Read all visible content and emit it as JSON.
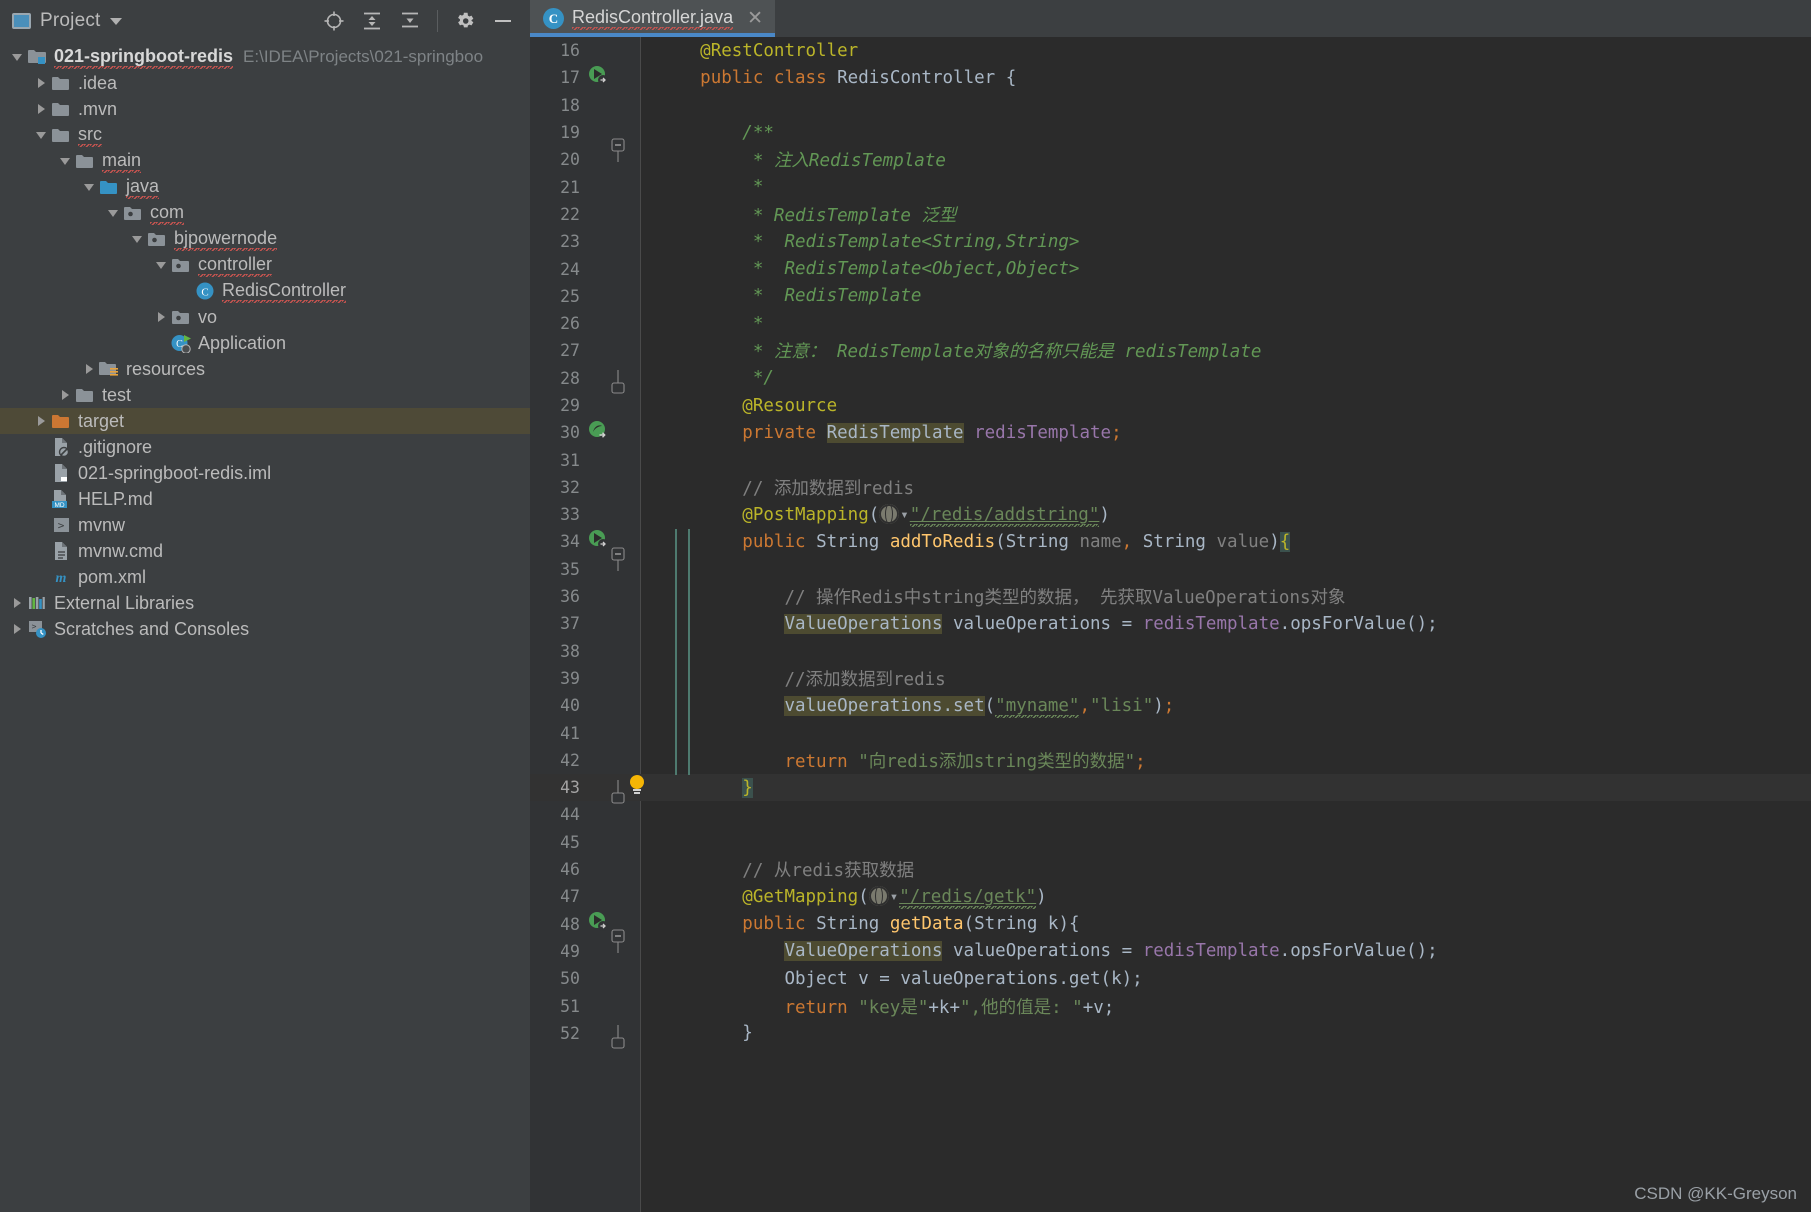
{
  "project_panel": {
    "header": {
      "title": "Project",
      "icon": "project-window-icon",
      "dropdown_icon": "chevron-down-icon",
      "buttons": [
        {
          "name": "select-opened-file-icon",
          "label": "Select Opened File"
        },
        {
          "name": "expand-all-icon",
          "label": "Expand All"
        },
        {
          "name": "collapse-all-icon",
          "label": "Collapse All"
        },
        {
          "name": "gear-icon",
          "label": "Options"
        },
        {
          "name": "minimize-icon",
          "label": "Hide"
        }
      ]
    },
    "tree": [
      {
        "label": "021-springboot-redis",
        "sub": "E:\\IDEA\\Projects\\021-springboo",
        "icon": "module-folder-icon",
        "depth": 0,
        "arrow": "down",
        "bold": true,
        "squiggly": true
      },
      {
        "label": ".idea",
        "icon": "folder-icon",
        "depth": 1,
        "arrow": "right"
      },
      {
        "label": ".mvn",
        "icon": "folder-icon",
        "depth": 1,
        "arrow": "right"
      },
      {
        "label": "src",
        "icon": "folder-icon",
        "depth": 1,
        "arrow": "down",
        "squiggly": true
      },
      {
        "label": "main",
        "icon": "folder-icon",
        "depth": 2,
        "arrow": "down",
        "squiggly": true
      },
      {
        "label": "java",
        "icon": "source-root-icon",
        "depth": 3,
        "arrow": "down",
        "squiggly": true
      },
      {
        "label": "com",
        "icon": "package-icon",
        "depth": 4,
        "arrow": "down",
        "squiggly": true
      },
      {
        "label": "bjpowernode",
        "icon": "package-icon",
        "depth": 5,
        "arrow": "down",
        "squiggly": true
      },
      {
        "label": "controller",
        "icon": "package-icon",
        "depth": 6,
        "arrow": "down",
        "squiggly": true
      },
      {
        "label": "RedisController",
        "icon": "java-class-icon",
        "depth": 7,
        "arrow": "none",
        "squiggly": true
      },
      {
        "label": "vo",
        "icon": "package-icon",
        "depth": 6,
        "arrow": "right"
      },
      {
        "label": "Application",
        "icon": "spring-boot-class-icon",
        "depth": 6,
        "arrow": "none"
      },
      {
        "label": "resources",
        "icon": "resources-folder-icon",
        "depth": 3,
        "arrow": "right"
      },
      {
        "label": "test",
        "icon": "folder-icon",
        "depth": 2,
        "arrow": "right"
      },
      {
        "label": "target",
        "icon": "excluded-folder-icon",
        "depth": 1,
        "arrow": "right",
        "selected": true
      },
      {
        "label": ".gitignore",
        "icon": "gitignore-file-icon",
        "depth": 1,
        "arrow": "none"
      },
      {
        "label": "021-springboot-redis.iml",
        "icon": "iml-file-icon",
        "depth": 1,
        "arrow": "none"
      },
      {
        "label": "HELP.md",
        "icon": "markdown-file-icon",
        "depth": 1,
        "arrow": "none"
      },
      {
        "label": "mvnw",
        "icon": "shell-script-icon",
        "depth": 1,
        "arrow": "none"
      },
      {
        "label": "mvnw.cmd",
        "icon": "cmd-script-icon",
        "depth": 1,
        "arrow": "none"
      },
      {
        "label": "pom.xml",
        "icon": "maven-file-icon",
        "depth": 1,
        "arrow": "none"
      },
      {
        "label": "External Libraries",
        "icon": "libraries-icon",
        "depth": 0,
        "arrow": "right"
      },
      {
        "label": "Scratches and Consoles",
        "icon": "scratches-icon",
        "depth": 0,
        "arrow": "right"
      }
    ]
  },
  "editor": {
    "tab": {
      "label": "RedisController.java",
      "icon": "java-class-icon",
      "close_icon": "close-icon"
    },
    "first_line_number": 16,
    "current_line": 43,
    "lines": [
      {
        "n": 16,
        "indent": 1,
        "tokens": [
          {
            "t": "@RestController",
            "c": "ann"
          }
        ]
      },
      {
        "n": 17,
        "indent": 1,
        "gutter": "run",
        "tokens": [
          {
            "t": "public ",
            "c": "kw"
          },
          {
            "t": "class ",
            "c": "kw"
          },
          {
            "t": "RedisController ",
            "c": "cls"
          },
          {
            "t": "{",
            "c": "ident"
          }
        ]
      },
      {
        "n": 18,
        "indent": 1,
        "tokens": []
      },
      {
        "n": 19,
        "indent": 2,
        "fold": "top",
        "tokens": [
          {
            "t": "/**",
            "c": "jdoc"
          }
        ]
      },
      {
        "n": 20,
        "indent": 2,
        "tokens": [
          {
            "t": " * 注入RedisTemplate",
            "c": "jdoc"
          }
        ]
      },
      {
        "n": 21,
        "indent": 2,
        "tokens": [
          {
            "t": " *",
            "c": "jdoc"
          }
        ]
      },
      {
        "n": 22,
        "indent": 2,
        "tokens": [
          {
            "t": " * RedisTemplate 泛型",
            "c": "jdoc"
          }
        ]
      },
      {
        "n": 23,
        "indent": 2,
        "tokens": [
          {
            "t": " *  RedisTemplate<String,String>",
            "c": "jdoc"
          }
        ]
      },
      {
        "n": 24,
        "indent": 2,
        "tokens": [
          {
            "t": " *  RedisTemplate<Object,Object>",
            "c": "jdoc"
          }
        ]
      },
      {
        "n": 25,
        "indent": 2,
        "tokens": [
          {
            "t": " *  RedisTemplate",
            "c": "jdoc"
          }
        ]
      },
      {
        "n": 26,
        "indent": 2,
        "tokens": [
          {
            "t": " *",
            "c": "jdoc"
          }
        ]
      },
      {
        "n": 27,
        "indent": 2,
        "tokens": [
          {
            "t": " * 注意： RedisTemplate对象的名称只能是 redisTemplate",
            "c": "jdoc"
          }
        ]
      },
      {
        "n": 28,
        "indent": 2,
        "fold": "bottom",
        "tokens": [
          {
            "t": " */",
            "c": "jdoc"
          }
        ]
      },
      {
        "n": 29,
        "indent": 2,
        "tokens": [
          {
            "t": "@Resource",
            "c": "ann"
          }
        ]
      },
      {
        "n": 30,
        "indent": 2,
        "gutter": "bean",
        "tokens": [
          {
            "t": "private ",
            "c": "kw"
          },
          {
            "t": "RedisTemplate",
            "c": "mark"
          },
          {
            "t": " ",
            "c": "ident"
          },
          {
            "t": "redisTemplate",
            "c": "fld"
          },
          {
            "t": ";",
            "c": "kw"
          }
        ]
      },
      {
        "n": 31,
        "indent": 2,
        "tokens": []
      },
      {
        "n": 32,
        "indent": 2,
        "tokens": [
          {
            "t": "// 添加数据到redis",
            "c": "cmt"
          }
        ]
      },
      {
        "n": 33,
        "indent": 2,
        "tokens": [
          {
            "t": "@PostMapping",
            "c": "ann"
          },
          {
            "t": "(",
            "c": "ident"
          },
          {
            "t": "GLOBE",
            "c": "globe"
          },
          {
            "t": "\"/redis/addstring\"",
            "c": "urlstr"
          },
          {
            "t": ")",
            "c": "ident"
          }
        ]
      },
      {
        "n": 34,
        "indent": 2,
        "gutter": "run",
        "fold": "top",
        "tokens": [
          {
            "t": "public ",
            "c": "kw"
          },
          {
            "t": "String ",
            "c": "typ"
          },
          {
            "t": "addToRedis",
            "c": "mth"
          },
          {
            "t": "(",
            "c": "ident"
          },
          {
            "t": "String ",
            "c": "typ"
          },
          {
            "t": "name",
            "c": "cmt"
          },
          {
            "t": ", ",
            "c": "kw"
          },
          {
            "t": "String ",
            "c": "typ"
          },
          {
            "t": "value",
            "c": "cmt"
          },
          {
            "t": ")",
            "c": "ident"
          },
          {
            "t": "{",
            "c": "brace-hl"
          }
        ]
      },
      {
        "n": 35,
        "indent": 2,
        "tokens": []
      },
      {
        "n": 36,
        "indent": 3,
        "tokens": [
          {
            "t": "// 操作Redis中string类型的数据， 先获取ValueOperations对象",
            "c": "cmt"
          }
        ]
      },
      {
        "n": 37,
        "indent": 3,
        "tokens": [
          {
            "t": "ValueOperations",
            "c": "mark"
          },
          {
            "t": " valueOperations ",
            "c": "ident"
          },
          {
            "t": "= ",
            "c": "ident"
          },
          {
            "t": "redisTemplate",
            "c": "fld"
          },
          {
            "t": ".opsForValue();",
            "c": "ident"
          }
        ]
      },
      {
        "n": 38,
        "indent": 3,
        "tokens": []
      },
      {
        "n": 39,
        "indent": 3,
        "tokens": [
          {
            "t": "//添加数据到redis",
            "c": "cmt"
          }
        ]
      },
      {
        "n": 40,
        "indent": 3,
        "tokens": [
          {
            "t": "valueOperations.set",
            "c": "mark"
          },
          {
            "t": "(",
            "c": "ident"
          },
          {
            "t": "\"myname\"",
            "c": "str-sq"
          },
          {
            "t": ",",
            "c": "kw"
          },
          {
            "t": "\"lisi\"",
            "c": "str"
          },
          {
            "t": ")",
            "c": "ident"
          },
          {
            "t": ";",
            "c": "kw"
          }
        ]
      },
      {
        "n": 41,
        "indent": 3,
        "tokens": []
      },
      {
        "n": 42,
        "indent": 3,
        "tokens": [
          {
            "t": "return ",
            "c": "kw"
          },
          {
            "t": "\"向redis添加string类型的数据\"",
            "c": "str"
          },
          {
            "t": ";",
            "c": "kw"
          }
        ]
      },
      {
        "n": 43,
        "indent": 2,
        "current": true,
        "gutter": "bulb",
        "fold": "bottom",
        "tokens": [
          {
            "t": "}",
            "c": "brace-hl"
          }
        ]
      },
      {
        "n": 44,
        "indent": 2,
        "tokens": []
      },
      {
        "n": 45,
        "indent": 2,
        "tokens": []
      },
      {
        "n": 46,
        "indent": 2,
        "tokens": [
          {
            "t": "// 从redis获取数据",
            "c": "cmt"
          }
        ]
      },
      {
        "n": 47,
        "indent": 2,
        "tokens": [
          {
            "t": "@GetMapping",
            "c": "ann"
          },
          {
            "t": "(",
            "c": "ident"
          },
          {
            "t": "GLOBE",
            "c": "globe"
          },
          {
            "t": "\"/redis/getk\"",
            "c": "urlstr"
          },
          {
            "t": ")",
            "c": "ident"
          }
        ]
      },
      {
        "n": 48,
        "indent": 2,
        "gutter": "run",
        "fold": "top",
        "tokens": [
          {
            "t": "public ",
            "c": "kw"
          },
          {
            "t": "String ",
            "c": "typ"
          },
          {
            "t": "getData",
            "c": "mth"
          },
          {
            "t": "(",
            "c": "ident"
          },
          {
            "t": "String ",
            "c": "typ"
          },
          {
            "t": "k",
            "c": "ident"
          },
          {
            "t": "){",
            "c": "ident"
          }
        ]
      },
      {
        "n": 49,
        "indent": 3,
        "tokens": [
          {
            "t": "ValueOperations",
            "c": "mark"
          },
          {
            "t": " valueOperations ",
            "c": "ident"
          },
          {
            "t": "= ",
            "c": "ident"
          },
          {
            "t": "redisTemplate",
            "c": "fld"
          },
          {
            "t": ".opsForValue();",
            "c": "ident"
          }
        ]
      },
      {
        "n": 50,
        "indent": 3,
        "tokens": [
          {
            "t": "Object ",
            "c": "typ"
          },
          {
            "t": "v ",
            "c": "ident"
          },
          {
            "t": "= valueOperations.get(k);",
            "c": "ident"
          }
        ]
      },
      {
        "n": 51,
        "indent": 3,
        "tokens": [
          {
            "t": "return ",
            "c": "kw"
          },
          {
            "t": "\"key是\"",
            "c": "str"
          },
          {
            "t": "+k+",
            "c": "ident"
          },
          {
            "t": "\",他的值是: \"",
            "c": "str"
          },
          {
            "t": "+v;",
            "c": "ident"
          }
        ]
      },
      {
        "n": 52,
        "indent": 2,
        "fold": "bottom",
        "tokens": [
          {
            "t": "}",
            "c": "ident"
          }
        ]
      }
    ]
  },
  "watermark": "CSDN @KK-Greyson",
  "colors": {
    "panel_bg": "#3c3f41",
    "editor_bg": "#2b2b2b",
    "gutter_bg": "#313335",
    "selection": "#4e4a37",
    "accent": "#4a88c7",
    "keyword": "#cc7832",
    "annotation": "#bbb529",
    "string": "#6a8759",
    "comment": "#808080",
    "javadoc": "#629755",
    "field": "#9876aa",
    "method": "#ffc66d",
    "mark_bg": "#4d4b31"
  }
}
